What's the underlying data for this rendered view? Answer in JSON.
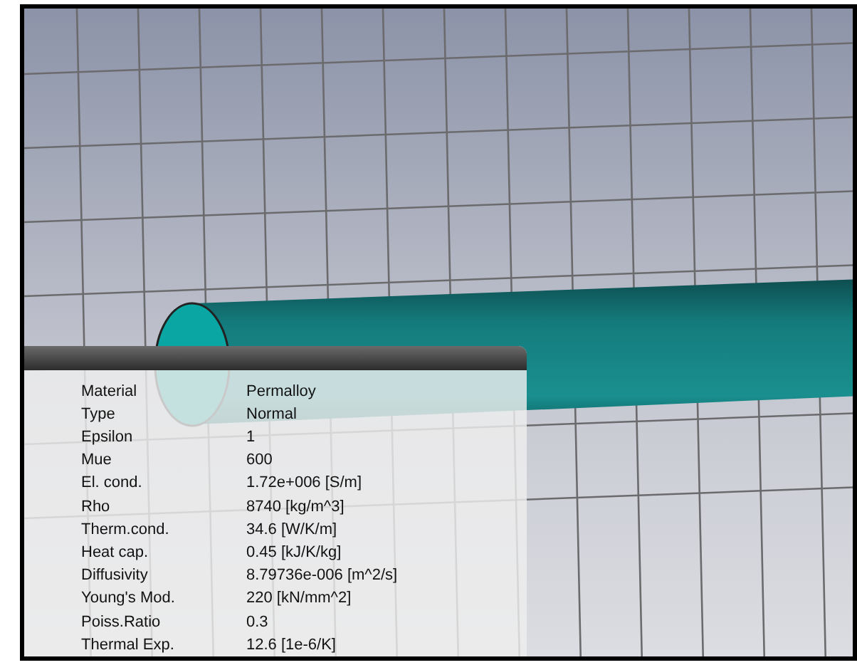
{
  "material_info": {
    "properties": [
      {
        "label": "Material",
        "value": "Permalloy"
      },
      {
        "label": "Type",
        "value": "Normal"
      },
      {
        "label": "Epsilon",
        "value": "1"
      },
      {
        "label": "Mue",
        "value": "600"
      },
      {
        "label": "El. cond.",
        "value": "1.72e+006 [S/m]"
      },
      {
        "label": "Rho",
        "value": "8740 [kg/m^3]"
      },
      {
        "label": "Therm.cond.",
        "value": "34.6 [W/K/m]"
      },
      {
        "label": "Heat cap.",
        "value": "0.45 [kJ/K/kg]"
      },
      {
        "label": "Diffusivity",
        "value": "8.79736e-006 [m^2/s]"
      },
      {
        "label": "Young's Mod.",
        "value": "220 [kN/mm^2]"
      },
      {
        "label": "Poiss.Ratio",
        "value": "0.3"
      },
      {
        "label": "Thermal Exp.",
        "value": "12.6 [1e-6/K]"
      }
    ]
  }
}
